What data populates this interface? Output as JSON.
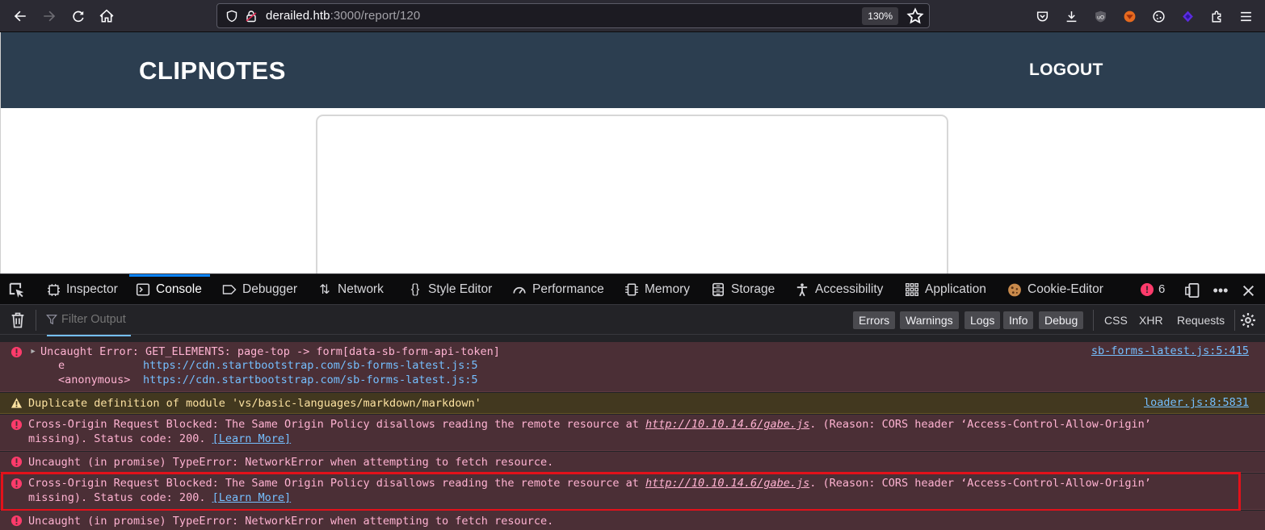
{
  "browser": {
    "url_host": "derailed.htb",
    "url_rest": ":3000/report/120",
    "zoom": "130%"
  },
  "site": {
    "brand": "CLIPNOTES",
    "logout": "LOGOUT"
  },
  "devtools": {
    "tabs": [
      {
        "label": "Inspector",
        "icon": "inspector-icon"
      },
      {
        "label": "Console",
        "icon": "console-icon"
      },
      {
        "label": "Debugger",
        "icon": "debugger-icon"
      },
      {
        "label": "Network",
        "icon": "network-icon"
      },
      {
        "label": "Style Editor",
        "icon": "style-editor-icon"
      },
      {
        "label": "Performance",
        "icon": "performance-icon"
      },
      {
        "label": "Memory",
        "icon": "memory-icon"
      },
      {
        "label": "Storage",
        "icon": "storage-icon"
      },
      {
        "label": "Accessibility",
        "icon": "accessibility-icon"
      },
      {
        "label": "Application",
        "icon": "application-icon"
      },
      {
        "label": "Cookie-Editor",
        "icon": "cookie-icon"
      }
    ],
    "error_count": "6",
    "filter_placeholder": "Filter Output",
    "level_filters": [
      "Errors",
      "Warnings",
      "Logs",
      "Info",
      "Debug"
    ],
    "type_filters": [
      "CSS",
      "XHR",
      "Requests"
    ]
  },
  "console": {
    "msg1": {
      "text": "Uncaught Error: GET_ELEMENTS: page-top -> form[data-sb-form-api-token]",
      "source": "sb-forms-latest.js:5:415",
      "stack": [
        {
          "fn": "e",
          "url": "https://cdn.startbootstrap.com/sb-forms-latest.js:5"
        },
        {
          "fn": "<anonymous>",
          "url": "https://cdn.startbootstrap.com/sb-forms-latest.js:5"
        }
      ]
    },
    "msg2": {
      "text": "Duplicate definition of module 'vs/basic-languages/markdown/markdown'",
      "source": "loader.js:8:5831"
    },
    "msg3": {
      "pre": "Cross-Origin Request Blocked: The Same Origin Policy disallows reading the remote resource at ",
      "link": "http://10.10.14.6/gabe.js",
      "post": ". (Reason: CORS header ‘Access-Control-Allow-Origin’",
      "line2": "missing). Status code: 200. ",
      "learn": "[Learn More]"
    },
    "msg4": {
      "text": "Uncaught (in promise) TypeError: NetworkError when attempting to fetch resource."
    },
    "msg5": {
      "pre": "Cross-Origin Request Blocked: The Same Origin Policy disallows reading the remote resource at ",
      "link": "http://10.10.14.6/gabe.js",
      "post": ". (Reason: CORS header ‘Access-Control-Allow-Origin’",
      "line2": "missing). Status code: 200. ",
      "learn": "[Learn More]"
    },
    "msg6": {
      "text": "Uncaught (in promise) TypeError: NetworkError when attempting to fetch resource."
    }
  }
}
